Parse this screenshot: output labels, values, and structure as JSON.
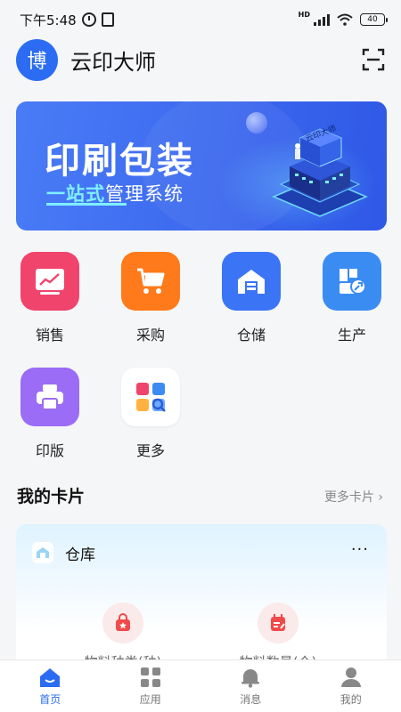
{
  "status_bar": {
    "time": "下午5:48",
    "network_badge": "HD",
    "battery": "40"
  },
  "header": {
    "avatar_text": "博",
    "app_title": "云印大师",
    "scan_icon": "scan-icon"
  },
  "banner": {
    "title": "印刷包装",
    "subtitle_highlight": "一站式",
    "subtitle_rest": "管理系统",
    "illustration_label": "云印大师"
  },
  "apps": [
    {
      "label": "销售",
      "icon": "sales-chart-icon",
      "color": "#f0446c"
    },
    {
      "label": "采购",
      "icon": "shopping-cart-icon",
      "color": "#ff7a1a"
    },
    {
      "label": "仓储",
      "icon": "warehouse-icon",
      "color": "#3b74f5"
    },
    {
      "label": "生产",
      "icon": "production-icon",
      "color": "#3b8cf2"
    },
    {
      "label": "印版",
      "icon": "printer-icon",
      "color": "#9b6cf5"
    },
    {
      "label": "更多",
      "icon": "more-apps-icon",
      "color": "#ffffff"
    }
  ],
  "cards_section": {
    "title": "我的卡片",
    "more_label": "更多卡片 ›"
  },
  "card": {
    "title": "仓库",
    "menu_label": "···",
    "stats": [
      {
        "label": "物料种类(种)",
        "icon": "bag-icon"
      },
      {
        "label": "物料数量(个)",
        "icon": "calendar-note-icon"
      }
    ]
  },
  "bottom_nav": [
    {
      "label": "首页",
      "icon": "home-icon",
      "active": true
    },
    {
      "label": "应用",
      "icon": "apps-grid-icon",
      "active": false
    },
    {
      "label": "消息",
      "icon": "bell-icon",
      "active": false
    },
    {
      "label": "我的",
      "icon": "user-icon",
      "active": false
    }
  ],
  "colors": {
    "accent": "#2b6cf2",
    "background": "#f5f6f8"
  }
}
